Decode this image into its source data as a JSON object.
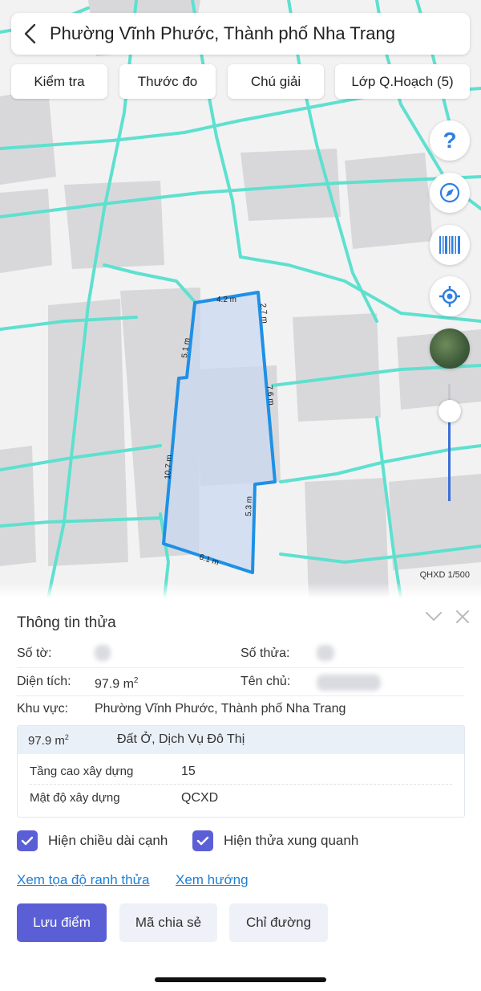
{
  "header": {
    "title": "Phường Vĩnh Phước, Thành phố Nha Trang"
  },
  "toolbar": [
    "Kiểm tra",
    "Thước đo",
    "Chú giải",
    "Lớp Q.Hoạch (5)"
  ],
  "map": {
    "parcel_edges": [
      "4.2 m",
      "2.7 m",
      "7.6 m",
      "5.3 m",
      "6.1 m",
      "10.7 m",
      "5.1 m"
    ],
    "scale_label": "QHXD 1/500",
    "colors": {
      "parcel_border": "#1e90e6",
      "parcel_fill": "#c9d8f0",
      "boundary_lines": "#5fe0cf",
      "buildings": "#d6d6d9"
    }
  },
  "controls": {
    "icons": [
      "help-icon",
      "compass-icon",
      "barcode-icon",
      "locate-icon",
      "satellite-layer-icon"
    ],
    "accent": "#2f7fe0"
  },
  "sheet": {
    "title": "Thông tin thửa",
    "so_to_label": "Số tờ:",
    "so_thua_label": "Số thửa:",
    "dien_tich_label": "Diện tích:",
    "dien_tich_value": "97.9 m",
    "dien_tich_unit_sup": "2",
    "ten_chu_label": "Tên chủ:",
    "khu_vuc_label": "Khu vực:",
    "khu_vuc_value": "Phường Vĩnh Phước, Thành phố Nha Trang",
    "detail": {
      "area": "97.9 m",
      "area_sup": "2",
      "land_type": "Đất Ở, Dịch Vụ Đô Thị",
      "rows": [
        {
          "label": "Tầng cao xây dựng",
          "value": "15"
        },
        {
          "label": "Mật độ xây dựng",
          "value": "QCXD"
        }
      ]
    },
    "checkboxes": [
      {
        "label": "Hiện chiều dài cạnh",
        "checked": true
      },
      {
        "label": "Hiện thửa xung quanh",
        "checked": true
      }
    ],
    "links": [
      "Xem tọa độ ranh thửa",
      "Xem hướng"
    ],
    "buttons": [
      "Lưu điểm",
      "Mã chia sẻ",
      "Chỉ đường"
    ],
    "accent": "#5b5fd6"
  }
}
